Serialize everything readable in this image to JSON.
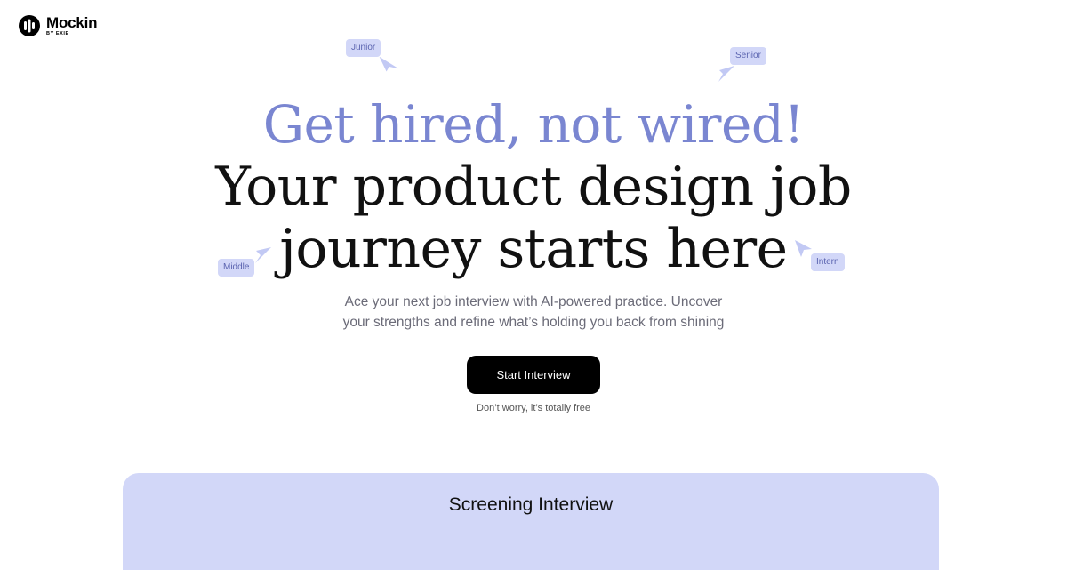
{
  "brand": {
    "name": "Mockin",
    "tagline": "BY EXIE"
  },
  "tags": {
    "junior": "Junior",
    "senior": "Senior",
    "middle": "Middle",
    "intern": "Intern"
  },
  "hero": {
    "accent_title": "Get hired, not wired!",
    "title_line1": "Your product design job",
    "title_line2": "journey starts here",
    "subtitle_line1": "Ace your next job interview with AI-powered practice. Uncover",
    "subtitle_line2": "your strengths and refine what’s holding you back from shining",
    "cta_label": "Start Interview",
    "cta_note": "Don’t worry, it’s totally free"
  },
  "panel": {
    "title": "Screening Interview"
  },
  "colors": {
    "accent": "#7a86d1",
    "tag_bg": "#d2d7f8",
    "tag_text": "#5b64b0",
    "cta_bg": "#000000",
    "panel_bg": "#d2d7f8"
  }
}
